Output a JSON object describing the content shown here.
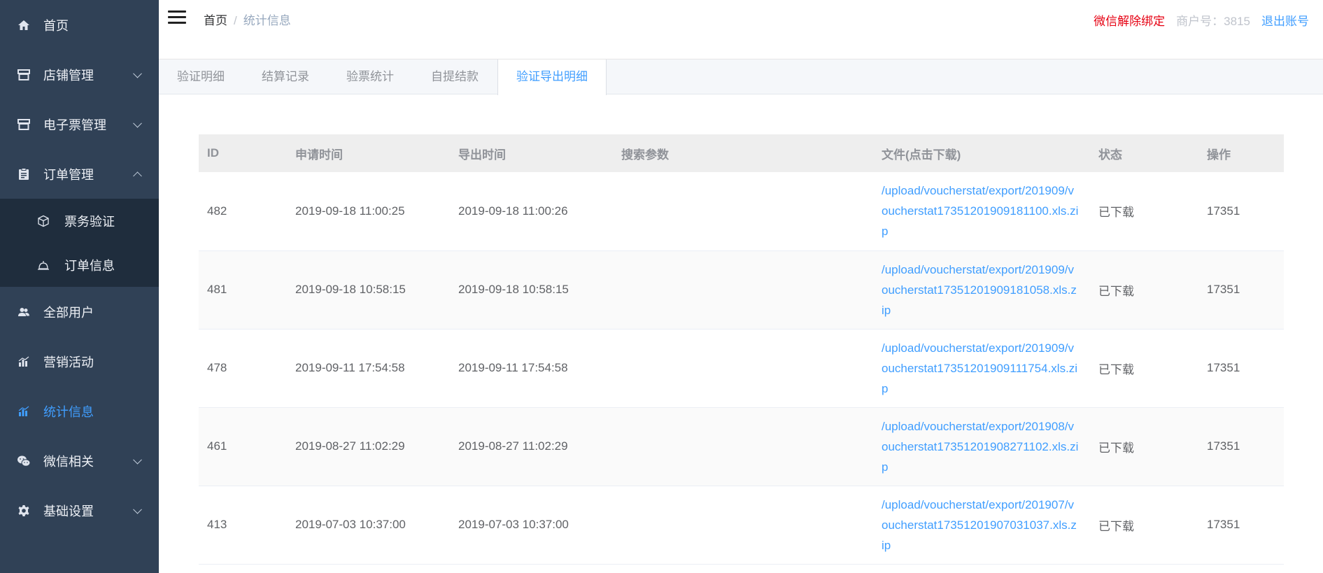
{
  "sidebar": {
    "items": [
      {
        "label": "首页",
        "icon": "home-icon"
      },
      {
        "label": "店铺管理",
        "icon": "store-icon"
      },
      {
        "label": "电子票管理",
        "icon": "ticket-store-icon"
      },
      {
        "label": "订单管理",
        "icon": "clipboard-icon"
      },
      {
        "label": "全部用户",
        "icon": "users-icon"
      },
      {
        "label": "营销活动",
        "icon": "bar-chart-icon"
      },
      {
        "label": "统计信息",
        "icon": "bar-chart-icon"
      },
      {
        "label": "微信相关",
        "icon": "wechat-icon"
      },
      {
        "label": "基础设置",
        "icon": "gear-icon"
      }
    ],
    "order_submenu": [
      {
        "label": "票务验证",
        "icon": "cube-icon"
      },
      {
        "label": "订单信息",
        "icon": "bell-icon"
      }
    ]
  },
  "header": {
    "breadcrumb_home": "首页",
    "breadcrumb_sep": "/",
    "breadcrumb_current": "统计信息",
    "unbind": "微信解除绑定",
    "merchant": "商户号：3815",
    "logout": "退出账号"
  },
  "tabs": [
    "验证明细",
    "结算记录",
    "验票统计",
    "自提结款",
    "验证导出明细"
  ],
  "table": {
    "headers": [
      "ID",
      "申请时间",
      "导出时间",
      "搜索参数",
      "文件(点击下载)",
      "状态",
      "操作"
    ],
    "rows": [
      {
        "id": "482",
        "apply": "2019-09-18 11:00:25",
        "export": "2019-09-18 11:00:26",
        "params": "",
        "file": "/upload/voucherstat/export/201909/voucherstat17351201909181100.xls.zip",
        "status": "已下载",
        "op": "17351"
      },
      {
        "id": "481",
        "apply": "2019-09-18 10:58:15",
        "export": "2019-09-18 10:58:15",
        "params": "",
        "file": "/upload/voucherstat/export/201909/voucherstat17351201909181058.xls.zip",
        "status": "已下载",
        "op": "17351"
      },
      {
        "id": "478",
        "apply": "2019-09-11 17:54:58",
        "export": "2019-09-11 17:54:58",
        "params": "",
        "file": "/upload/voucherstat/export/201909/voucherstat17351201909111754.xls.zip",
        "status": "已下载",
        "op": "17351"
      },
      {
        "id": "461",
        "apply": "2019-08-27 11:02:29",
        "export": "2019-08-27 11:02:29",
        "params": "",
        "file": "/upload/voucherstat/export/201908/voucherstat17351201908271102.xls.zip",
        "status": "已下载",
        "op": "17351"
      },
      {
        "id": "413",
        "apply": "2019-07-03 10:37:00",
        "export": "2019-07-03 10:37:00",
        "params": "",
        "file": "/upload/voucherstat/export/201907/voucherstat17351201907031037.xls.zip",
        "status": "已下载",
        "op": "17351"
      }
    ]
  }
}
